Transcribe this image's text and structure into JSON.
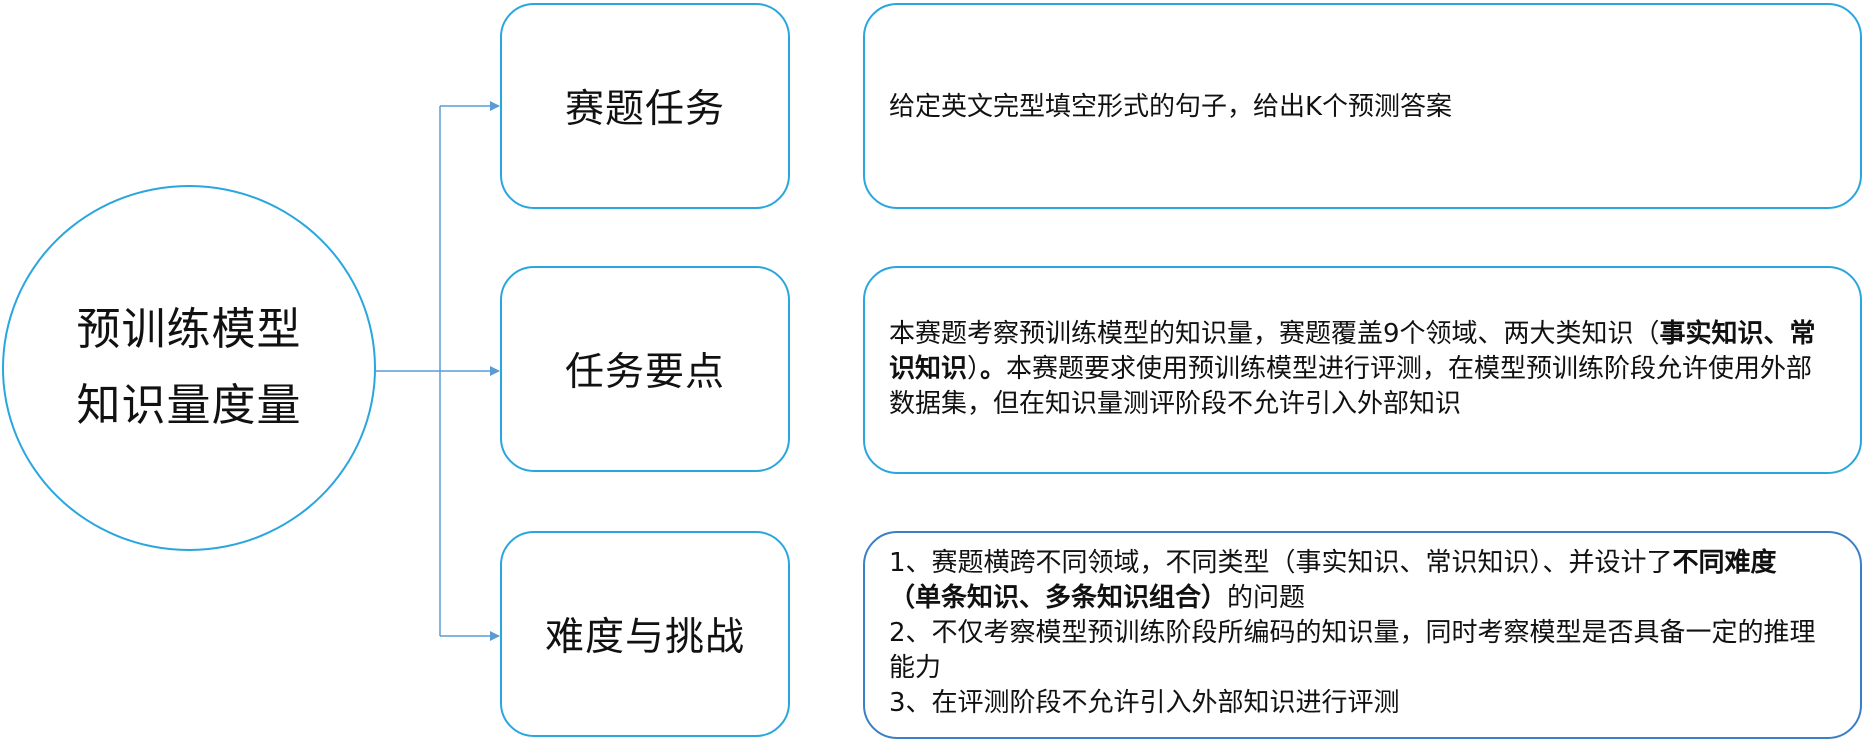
{
  "center": {
    "line1": "预训练模型",
    "line2": "知识量度量"
  },
  "nodes": [
    {
      "label": "赛题任务"
    },
    {
      "label": "任务要点"
    },
    {
      "label": "难度与挑战"
    }
  ],
  "details": {
    "task": {
      "text": "给定英文完型填空形式的句子，给出K个预测答案"
    },
    "points": {
      "part1": "本赛题考察预训练模型的知识量，赛题覆盖9个领域、两大类知识（",
      "bold1": "事实知识、常识知识",
      "part2": "）",
      "bold2": "。",
      "part3": "本赛题要求使用预训练模型进行评测，在模型预训练阶段允许使用外部数据集，但在知识量测评阶段不允许引入外部知识"
    },
    "difficulty": {
      "item1_part1": "1、赛题横跨不同领域，不同类型（事实知识、常识知识）、并设计了",
      "item1_bold": "不同难度（单条知识、多条知识组合）",
      "item1_part2": "的问题",
      "item2": "2、不仅考察模型预训练阶段所编码的知识量，同时考察模型是否具备一定的推理能力",
      "item3": "3、在评测阶段不允许引入外部知识进行评测"
    }
  },
  "colors": {
    "border": "#2aa6df",
    "connector": "#5b9bd5"
  }
}
